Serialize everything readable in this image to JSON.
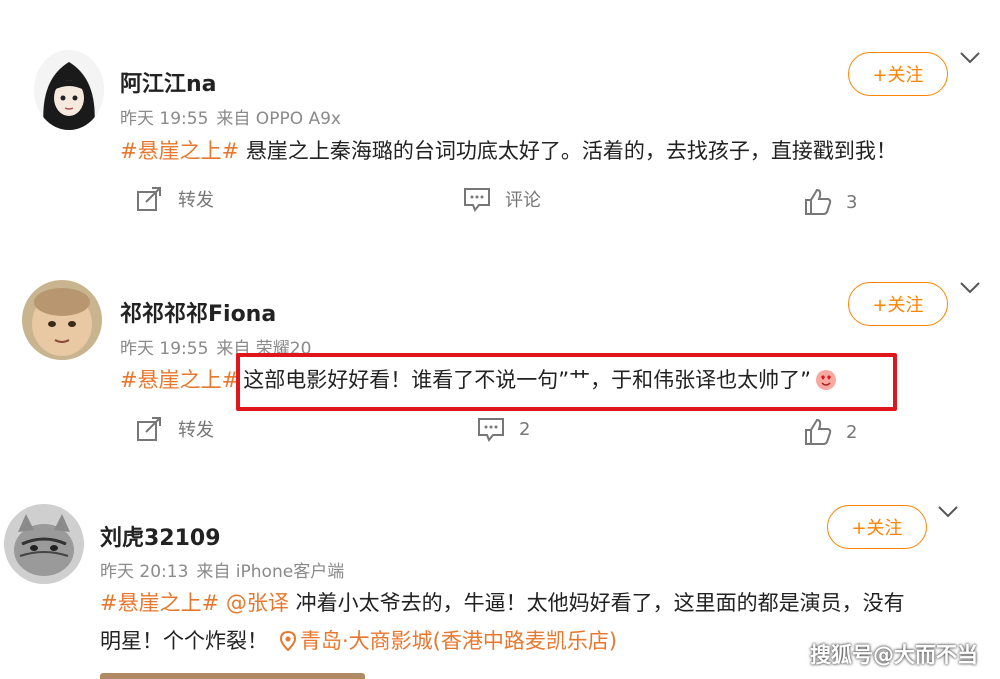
{
  "posts": [
    {
      "username": "阿江江na",
      "time": "昨天 19:55",
      "source": "来自 OPPO A9x",
      "hashtag": "#悬崖之上#",
      "text": " 悬崖之上秦海璐的台词功底太好了。活着的，去找孩子，直接戳到我！",
      "follow_label": "+关注",
      "repost_label": "转发",
      "comment_label": "评论",
      "like_count": "3"
    },
    {
      "username": "祁祁祁祁Fiona",
      "time": "昨天 19:55",
      "source": "来自 荣耀20",
      "hashtag": "#悬崖之上#",
      "text": "这部电影好好看！谁看了不说一句”艹，于和伟张译也太帅了”",
      "follow_label": "+关注",
      "repost_label": "转发",
      "comment_count": "2",
      "like_count": "2"
    },
    {
      "username": "刘虎32109",
      "time": "昨天 20:13",
      "source": "来自 iPhone客户端",
      "hashtag": "#悬崖之上#",
      "mention": "@张译",
      "text_line1": " 冲着小太爷去的，牛逼！太他妈好看了，这里面的都是演员，没有",
      "text_line2": "明星！个个炸裂！",
      "location": "青岛·大商影城(香港中路麦凯乐店)",
      "follow_label": "+关注"
    }
  ],
  "watermark": "搜狐号@大而不当",
  "colors": {
    "accent": "#ff8200",
    "tag": "#e8772e",
    "highlight": "#e0161d"
  },
  "icons": [
    "repost-icon",
    "comment-icon",
    "like-icon",
    "chevron-down-icon",
    "location-pin-icon",
    "emoji-heart-eyes-icon"
  ]
}
